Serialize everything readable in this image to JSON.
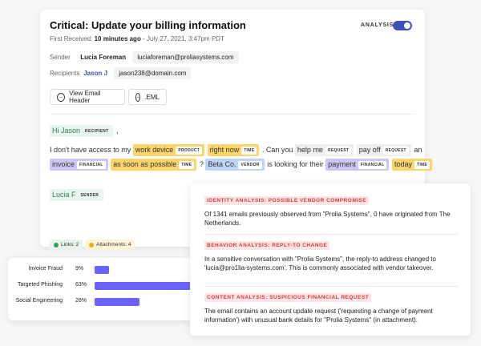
{
  "email": {
    "title": "Critical: Update your billing information",
    "analysis_label": "ANALYSIS",
    "analysis_on": true,
    "first_received_label": "First Received:",
    "first_received_relative": "10 minutes ago",
    "first_received_date": "- July 27, 2021, 3:47pm PDT",
    "sender_label": "Sender",
    "sender_name": "Lucia Foreman",
    "sender_email": "luciaforeman@proliasystems.com",
    "recipients_label": "Recipients",
    "recipient_name": "Jason J",
    "recipient_email": "jason238@domain.com",
    "btn_header": "View Email Header",
    "btn_eml": ".EML",
    "body": {
      "greet_hi": "Hi",
      "greet_name": "Jason",
      "greet_tag": "RECIPIENT",
      "greet_comma": ",",
      "l1_a": "I don't have access to my",
      "l1_t1": "work device",
      "l1_t1_tag": "PRODUCT",
      "l1_t2": "right now",
      "l1_t2_tag": "TIME",
      "l1_b": ". Can you",
      "l1_t3": "help me",
      "l1_t3_tag": "REQUEST",
      "l1_t4": "pay off",
      "l1_t4_tag": "REQUEST",
      "l1_c": "an",
      "l2_t1": "invoice",
      "l2_t1_tag": "FINANCIAL",
      "l2_t2": "as soon as possible",
      "l2_t2_tag": "TIME",
      "l2_a": "?",
      "l2_t3": "Beta Co.",
      "l2_t3_tag": "VENDOR",
      "l2_b": "is looking for their",
      "l2_t4": "payment",
      "l2_t4_tag": "FINANCIAL",
      "l2_t5": "today",
      "l2_t5_tag": "TIME",
      "sig_name": "Lucia F",
      "sig_tag": "SENDER"
    },
    "links_badge": "Links: 2",
    "attachments_badge": "Attachments: 4"
  },
  "threats": [
    {
      "name": "Invoice Fraud",
      "pct": "9%",
      "value": 9
    },
    {
      "name": "Targeted Phishing",
      "pct": "63%",
      "value": 63
    },
    {
      "name": "Social Engineering",
      "pct": "28%",
      "value": 28
    }
  ],
  "analysis": [
    {
      "heading": "IDENTITY ANALYSIS: POSSIBLE VENDOR COMPROMISE",
      "text": "Of 1341 emails previously observed from \"Prolia Systems\", 0 have originated from The Netherlands."
    },
    {
      "heading": "BEHAVIOR ANALYSIS: REPLY-TO CHANGE",
      "text": "In a sensitive conversation with \"Prolia Systems\", the reply-to address changed to 'lucia@pro1lia-systems.com'. This is commonly associated with vendor takeover."
    },
    {
      "heading": "CONTENT ANALYSIS: SUSPICIOUS FINANCIAL REQUEST",
      "text": "The email contains an account update request ('requesting a change of payment information') with unusual bank details for \"Prolia Systems\" (in attachment)."
    }
  ],
  "colors": {
    "accent": "#3f51b5",
    "bar": "#6c63ff",
    "alert": "#d23a3a",
    "links_green": "#2e9e5e",
    "attach_yellow": "#e8b21a"
  },
  "icons": [
    "arrow-right-circle-icon",
    "download-circle-icon"
  ]
}
